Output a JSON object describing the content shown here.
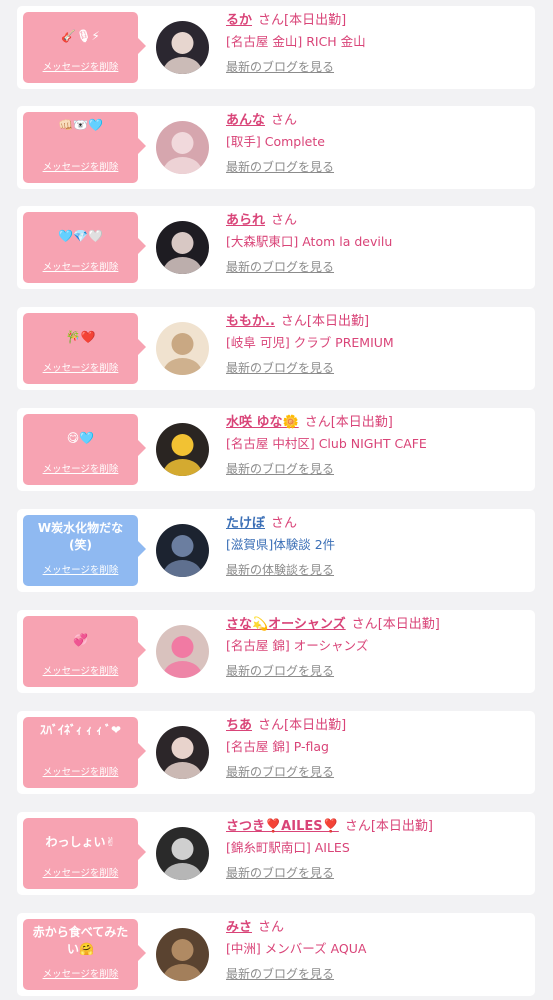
{
  "messages": [
    {
      "bubble": "🎸🎙⚡",
      "bubble_color": "#f7a3b2",
      "delete": "メッセージを削除",
      "name": "るか",
      "san": "さん",
      "status": "[本日出勤]",
      "shop": "[名古屋 金山] RICH 金山",
      "link": "最新のブログを見る",
      "avatar_colors": [
        "#2b2730",
        "#e7d6cf"
      ]
    },
    {
      "bubble": "👊🏻🐻‍❄️🩵",
      "bubble_color": "#f7a3b2",
      "delete": "メッセージを削除",
      "name": "あんな",
      "san": "さん",
      "status": "",
      "shop": "[取手] Complete",
      "link": "最新のブログを見る",
      "avatar_colors": [
        "#d6a6ae",
        "#f1d9dc"
      ]
    },
    {
      "bubble": "🩵💎🤍",
      "bubble_color": "#f7a3b2",
      "delete": "メッセージを削除",
      "name": "あられ",
      "san": "さん",
      "status": "",
      "shop": "[大森駅東口] Atom la devilu",
      "link": "最新のブログを見る",
      "avatar_colors": [
        "#1e1c22",
        "#d8c8c4"
      ]
    },
    {
      "bubble": "🎋❤️",
      "bubble_color": "#f7a3b2",
      "delete": "メッセージを削除",
      "name": "ももか..",
      "san": "さん",
      "status": "[本日出勤]",
      "shop": "[岐阜 可児] クラブ PREMIUM",
      "link": "最新のブログを見る",
      "avatar_colors": [
        "#f0e2cf",
        "#c9a883"
      ]
    },
    {
      "bubble": "😋🩵",
      "bubble_color": "#f7a3b2",
      "delete": "メッセージを削除",
      "name": "水咲 ゆな🌼",
      "san": "さん",
      "status": "[本日出勤]",
      "shop": "[名古屋 中村区] Club NIGHT CAFE",
      "link": "最新のブログを見る",
      "avatar_colors": [
        "#2a2522",
        "#f2c233"
      ]
    },
    {
      "bubble": "W炭水化物だな(笑)",
      "bubble_color": "#8fb9f1",
      "delete": "メッセージを削除",
      "name": "たけぼ",
      "san": "さん",
      "status": "",
      "shop": "[滋賀県]体験談 2件",
      "link": "最新の体験談を見る",
      "avatar_colors": [
        "#1c2330",
        "#6b7ea0"
      ]
    },
    {
      "bubble": "💞",
      "bubble_color": "#f7a3b2",
      "delete": "メッセージを削除",
      "name": "さな💫オーシャンズ",
      "san": "さん",
      "status": "[本日出勤]",
      "shop": "[名古屋 錦] オーシャンズ",
      "link": "最新のブログを見る",
      "avatar_colors": [
        "#d9c2be",
        "#f17aa3"
      ]
    },
    {
      "bubble": "ｽﾊﾞｲﾈﾞｨ ｨ ｨ ﾞ❤",
      "bubble_color": "#f7a3b2",
      "delete": "メッセージを削除",
      "name": "ちあ",
      "san": "さん",
      "status": "[本日出勤]",
      "shop": "[名古屋 錦] P-flag",
      "link": "最新のブログを見る",
      "avatar_colors": [
        "#2c2629",
        "#e8d3cc"
      ]
    },
    {
      "bubble": "わっしょい✌",
      "bubble_color": "#f7a3b2",
      "delete": "メッセージを削除",
      "name": "さつき❣️AILES❣️",
      "san": "さん",
      "status": "[本日出勤]",
      "shop": "[錦糸町駅南口] AILES",
      "link": "最新のブログを見る",
      "avatar_colors": [
        "#2a2a2a",
        "#cfcfcf"
      ]
    },
    {
      "bubble": "赤から食べてみたい🤗",
      "bubble_color": "#f7a3b2",
      "delete": "メッセージを削除",
      "name": "みさ",
      "san": "さん",
      "status": "",
      "shop": "[中洲] メンバーズ AQUA",
      "link": "最新のブログを見る",
      "avatar_colors": [
        "#5a4330",
        "#b08a63"
      ]
    }
  ]
}
